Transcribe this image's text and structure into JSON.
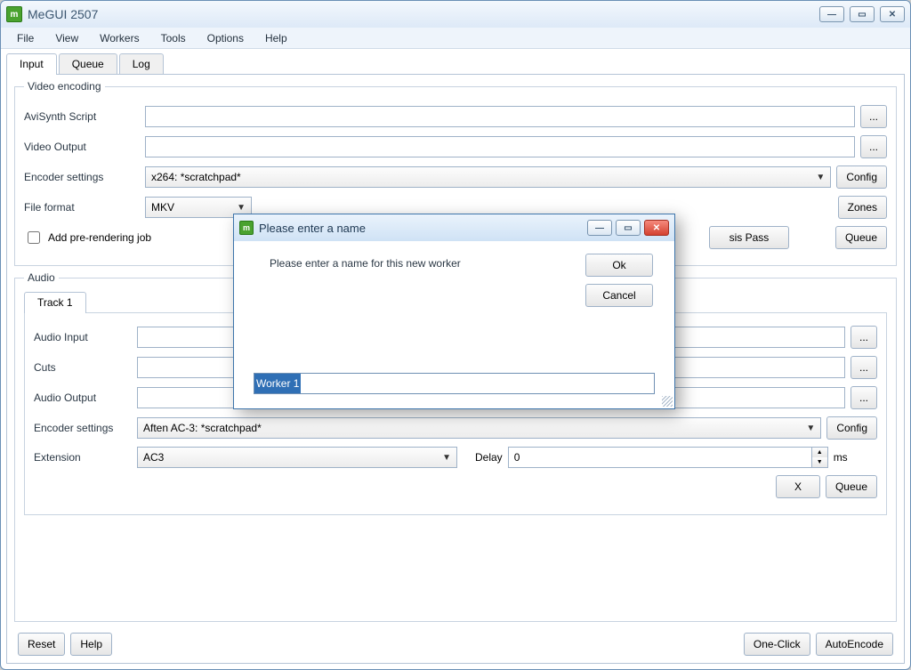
{
  "window": {
    "title": "MeGUI 2507"
  },
  "menu": {
    "file": "File",
    "view": "View",
    "workers": "Workers",
    "tools": "Tools",
    "options": "Options",
    "help": "Help"
  },
  "tabs": {
    "input": "Input",
    "queue": "Queue",
    "log": "Log"
  },
  "video": {
    "legend": "Video encoding",
    "avisynth_label": "AviSynth Script",
    "avisynth_value": "",
    "output_label": "Video Output",
    "output_value": "",
    "encoder_label": "Encoder settings",
    "encoder_value": "x264: *scratchpad*",
    "config_btn": "Config",
    "format_label": "File format",
    "format_value": "MKV",
    "zones_btn": "Zones",
    "prerender_label": "Add pre-rendering job",
    "analysis_btn_partial": "sis Pass",
    "queue_btn": "Queue",
    "browse": "..."
  },
  "audio": {
    "legend": "Audio",
    "track_tab": "Track 1",
    "input_label": "Audio Input",
    "input_value": "",
    "cuts_label": "Cuts",
    "cuts_value": "",
    "output_label": "Audio Output",
    "output_value": "",
    "encoder_label": "Encoder settings",
    "encoder_value": "Aften AC-3: *scratchpad*",
    "config_btn": "Config",
    "ext_label": "Extension",
    "ext_value": "AC3",
    "delay_label": "Delay",
    "delay_value": "0",
    "ms": "ms",
    "x_btn": "X",
    "queue_btn": "Queue",
    "browse": "..."
  },
  "bottom": {
    "reset": "Reset",
    "help": "Help",
    "oneclick": "One-Click",
    "autoencode": "AutoEncode"
  },
  "dialog": {
    "title": "Please enter a name",
    "message": "Please enter a name for this new worker",
    "ok": "Ok",
    "cancel": "Cancel",
    "input_value": "Worker 1"
  }
}
